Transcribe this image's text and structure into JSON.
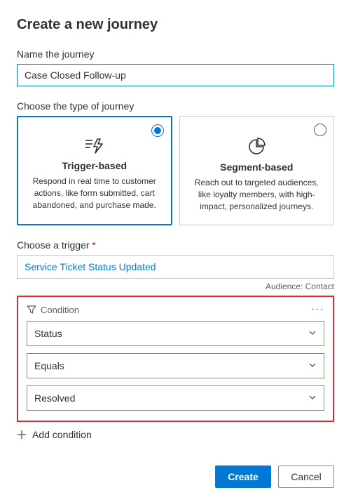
{
  "title": "Create a new journey",
  "name_label": "Name the journey",
  "name_value": "Case Closed Follow-up",
  "type_label": "Choose the type of journey",
  "cards": {
    "trigger": {
      "title": "Trigger-based",
      "desc": "Respond in real time to customer actions, like form submitted, cart abandoned, and purchase made."
    },
    "segment": {
      "title": "Segment-based",
      "desc": "Reach out to targeted audiences, like loyalty members, with high-impact, personalized journeys."
    }
  },
  "trigger": {
    "label": "Choose a trigger ",
    "required_marker": "*",
    "value": "Service Ticket Status Updated",
    "audience_label": "Audience: Contact"
  },
  "condition": {
    "header": "Condition",
    "attribute": "Status",
    "operator": "Equals",
    "value": "Resolved"
  },
  "add_condition_label": "Add condition",
  "buttons": {
    "create": "Create",
    "cancel": "Cancel"
  }
}
